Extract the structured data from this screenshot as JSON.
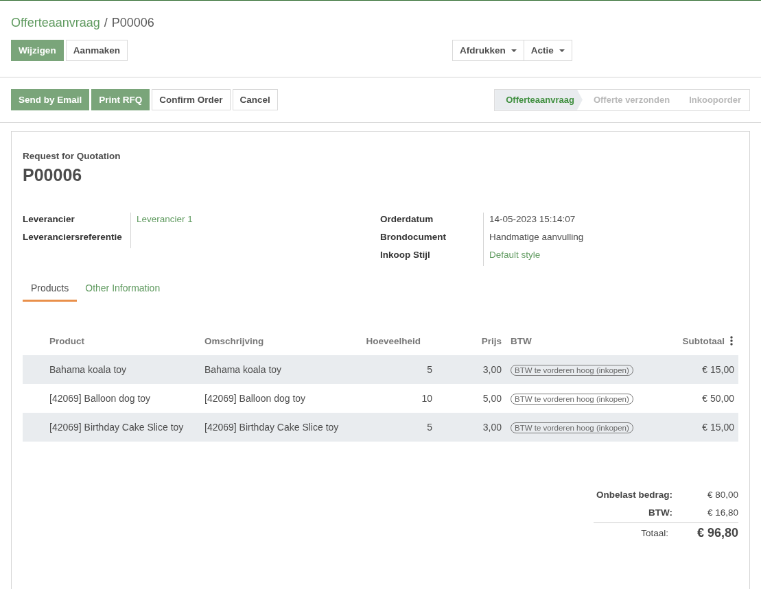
{
  "breadcrumb": {
    "parent": "Offerteaanvraag",
    "separator": "/",
    "current": "P00006"
  },
  "main_buttons": [
    {
      "label": "Wijzigen",
      "kind": "primary"
    },
    {
      "label": "Aanmaken",
      "kind": "secondary"
    }
  ],
  "dropdowns": [
    {
      "label": "Afdrukken"
    },
    {
      "label": "Actie"
    }
  ],
  "action_buttons": [
    {
      "label": "Send by Email",
      "kind": "primary"
    },
    {
      "label": "Print RFQ",
      "kind": "primary"
    },
    {
      "label": "Confirm Order",
      "kind": "secondary"
    },
    {
      "label": "Cancel",
      "kind": "secondary"
    }
  ],
  "status_steps": [
    {
      "label": "Offerteaanvraag",
      "selected": true
    },
    {
      "label": "Offerte verzonden",
      "selected": false
    },
    {
      "label": "Inkooporder",
      "selected": false
    }
  ],
  "sheet": {
    "subtitle": "Request for Quotation",
    "title": "P00006",
    "left_fields": [
      {
        "label": "Leverancier",
        "value": "Leverancier 1",
        "link": true
      },
      {
        "label": "Leveranciersreferentie"
      }
    ],
    "right_fields": [
      {
        "label": "Orderdatum",
        "value": "14-05-2023 15:14:07",
        "link": false
      },
      {
        "label": "Brondocument",
        "value": "Handmatige aanvulling",
        "link": false
      },
      {
        "label": "Inkoop Stijl",
        "value": "Default style",
        "link": true
      }
    ],
    "tabs": [
      {
        "label": "Products",
        "selected": true
      },
      {
        "label": "Other Information",
        "selected": false
      }
    ],
    "table": {
      "columns": [
        "Product",
        "Omschrijving",
        "Hoeveelheid",
        "Prijs",
        "BTW",
        "Subtotaal"
      ],
      "rows": [
        {
          "product": "Bahama koala toy",
          "description": "Bahama koala toy",
          "quantity": "5",
          "price": "3,00",
          "tax": "BTW te vorderen hoog (inkopen)",
          "subtotal": "€ 15,00"
        },
        {
          "product": "[42069] Balloon dog toy",
          "description": "[42069] Balloon dog toy",
          "quantity": "10",
          "price": "5,00",
          "tax": "BTW te vorderen hoog (inkopen)",
          "subtotal": "€ 50,00"
        },
        {
          "product": "[42069] Birthday Cake Slice toy",
          "description": "[42069] Birthday Cake Slice toy",
          "quantity": "5",
          "price": "3,00",
          "tax": "BTW te vorderen hoog (inkopen)",
          "subtotal": "€ 15,00"
        }
      ]
    },
    "totals": [
      {
        "label": "Onbelast bedrag:",
        "value": "€ 80,00",
        "kind": "line"
      },
      {
        "label": "BTW:",
        "value": "€ 16,80",
        "kind": "line"
      },
      {
        "label": "Totaal:",
        "value": "€ 96,80",
        "kind": "total"
      }
    ]
  }
}
